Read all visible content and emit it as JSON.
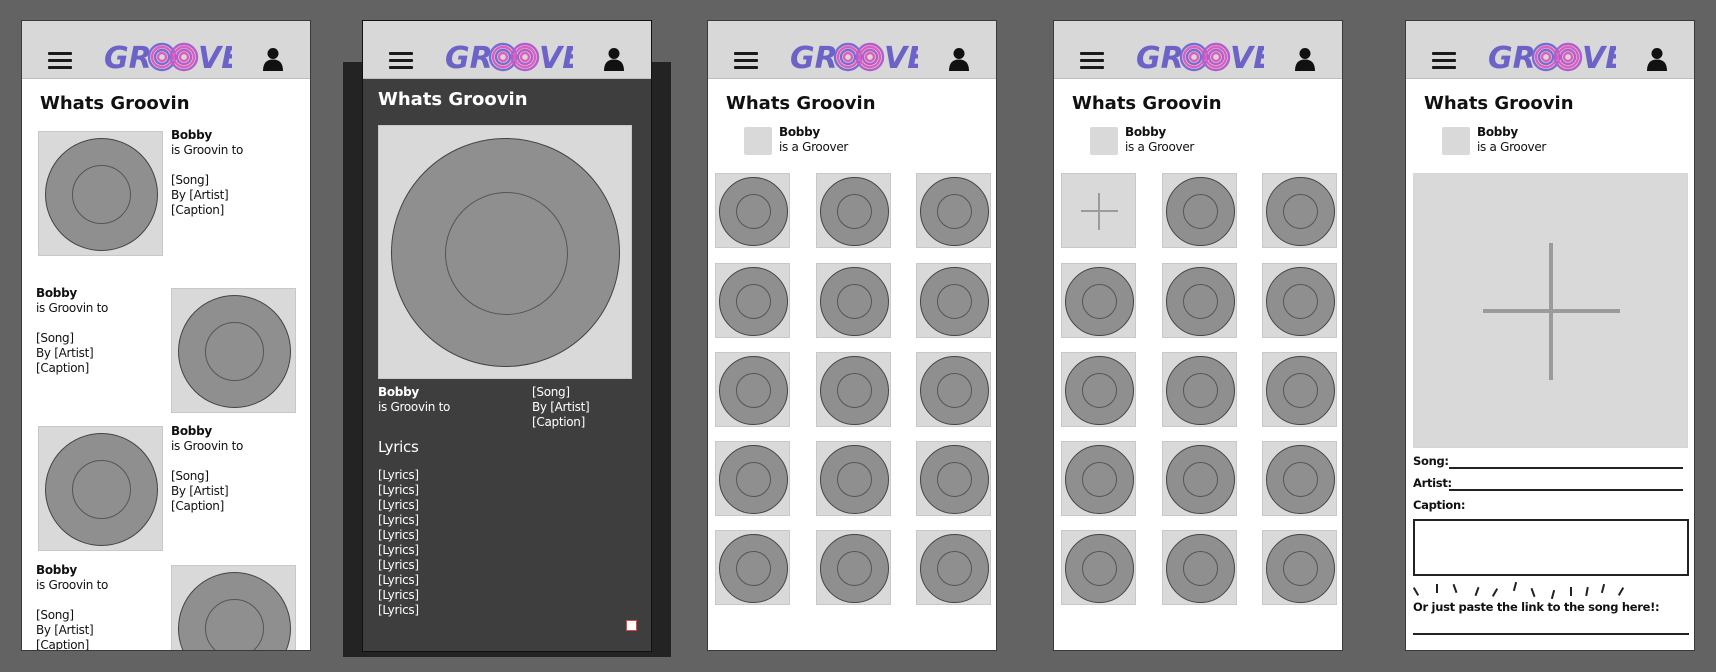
{
  "app": {
    "logo_text": "GROOVE",
    "accent_colors": {
      "logo_blue": "#6c63c9",
      "logo_purple": "#9b59d0",
      "logo_pink": "#e05dbb"
    },
    "icons": [
      "menu-icon",
      "user-icon",
      "disc-icon",
      "plus-icon"
    ]
  },
  "feed": {
    "title": "Whats Groovin",
    "posts": [
      {
        "user": "Bobby",
        "action": "is Groovin to",
        "song": "[Song]",
        "artist": "By [Artist]",
        "caption": "[Caption]"
      },
      {
        "user": "Bobby",
        "action": "is Groovin to",
        "song": "[Song]",
        "artist": "By [Artist]",
        "caption": "[Caption]"
      },
      {
        "user": "Bobby",
        "action": "is Groovin to",
        "song": "[Song]",
        "artist": "By [Artist]",
        "caption": "[Caption]"
      },
      {
        "user": "Bobby",
        "action": "is Groovin to",
        "song": "[Song]",
        "artist": "By [Artist]",
        "caption": "[Caption]"
      }
    ]
  },
  "detail": {
    "title": "Whats Groovin",
    "user": "Bobby",
    "action": "is Groovin to",
    "song": "[Song]",
    "artist": "By [Artist]",
    "caption": "[Caption]",
    "lyrics_heading": "Lyrics",
    "lyrics": [
      "[Lyrics]",
      "[Lyrics]",
      "[Lyrics]",
      "[Lyrics]",
      "[Lyrics]",
      "[Lyrics]",
      "[Lyrics]",
      "[Lyrics]",
      "[Lyrics]",
      "[Lyrics]"
    ]
  },
  "profile": {
    "title": "Whats Groovin",
    "user": "Bobby",
    "status": "is a Groover"
  },
  "profile_edit": {
    "title": "Whats Groovin",
    "user": "Bobby",
    "status": "is a Groover"
  },
  "add_song": {
    "title": "Whats Groovin",
    "user": "Bobby",
    "status": "is a Groover",
    "song_label": "Song:",
    "artist_label": "Artist:",
    "caption_label": "Caption:",
    "paste_label": "Or just paste the link to the song here!:"
  }
}
